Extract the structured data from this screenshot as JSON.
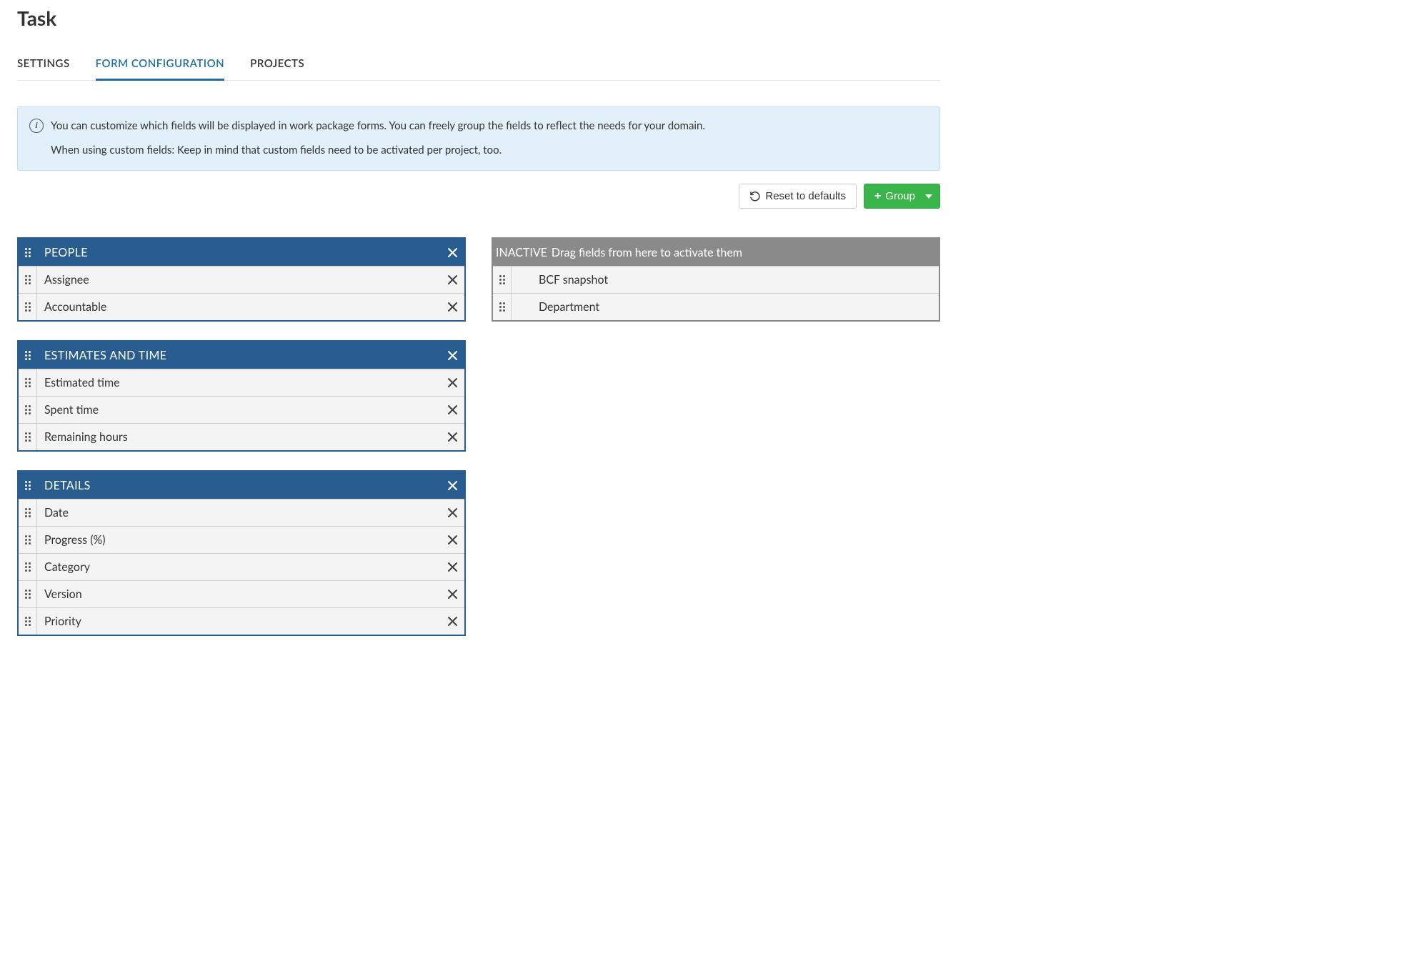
{
  "title": "Task",
  "tabs": [
    {
      "label": "SETTINGS",
      "active": false
    },
    {
      "label": "FORM CONFIGURATION",
      "active": true
    },
    {
      "label": "PROJECTS",
      "active": false
    }
  ],
  "info": {
    "line1": "You can customize which fields will be displayed in work package forms. You can freely group the fields to reflect the needs for your domain.",
    "line2": "When using custom fields: Keep in mind that custom fields need to be activated per project, too."
  },
  "toolbar": {
    "reset_label": "Reset to defaults",
    "group_label": "Group"
  },
  "groups": [
    {
      "title": "PEOPLE",
      "fields": [
        "Assignee",
        "Accountable"
      ]
    },
    {
      "title": "ESTIMATES AND TIME",
      "fields": [
        "Estimated time",
        "Spent time",
        "Remaining hours"
      ]
    },
    {
      "title": "DETAILS",
      "fields": [
        "Date",
        "Progress (%)",
        "Category",
        "Version",
        "Priority"
      ]
    }
  ],
  "inactive": {
    "title_strong": "INACTIVE",
    "title_rest": "Drag fields from here to activate them",
    "fields": [
      "BCF snapshot",
      "Department"
    ]
  }
}
